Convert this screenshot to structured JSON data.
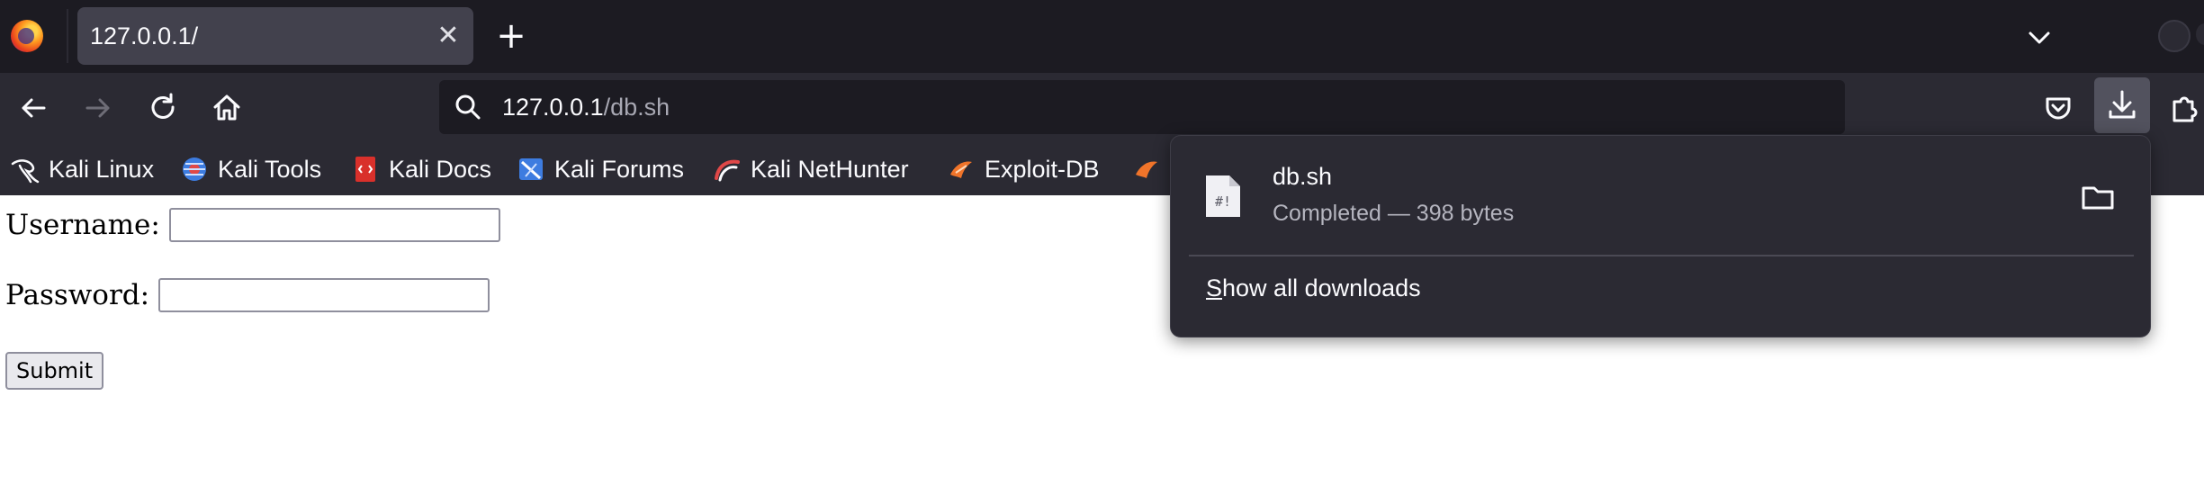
{
  "browser": {
    "tab": {
      "title": "127.0.0.1/"
    },
    "urlbar": {
      "host": "127.0.0.1",
      "path": "/db.sh"
    }
  },
  "bookmarks": [
    {
      "label": "Kali Linux",
      "icon": "kali-dragon-icon"
    },
    {
      "label": "Kali Tools",
      "icon": "kali-tools-icon"
    },
    {
      "label": "Kali Docs",
      "icon": "kali-docs-icon"
    },
    {
      "label": "Kali Forums",
      "icon": "kali-forums-icon"
    },
    {
      "label": "Kali NetHunter",
      "icon": "kali-nethunter-icon"
    },
    {
      "label": "Exploit-DB",
      "icon": "exploit-db-icon"
    }
  ],
  "form": {
    "username_label": "Username:",
    "password_label": "Password:",
    "submit_label": "Submit"
  },
  "downloads": {
    "file_name": "db.sh",
    "file_icon_text": "#!",
    "status": "Completed — 398 bytes",
    "show_all_first": "S",
    "show_all_rest": "how all downloads"
  },
  "colors": {
    "tabstrip_bg": "#1c1b22",
    "toolbar_bg": "#2b2a33",
    "panel_bg": "#2b2a33",
    "text_light": "#fbfbfe"
  }
}
